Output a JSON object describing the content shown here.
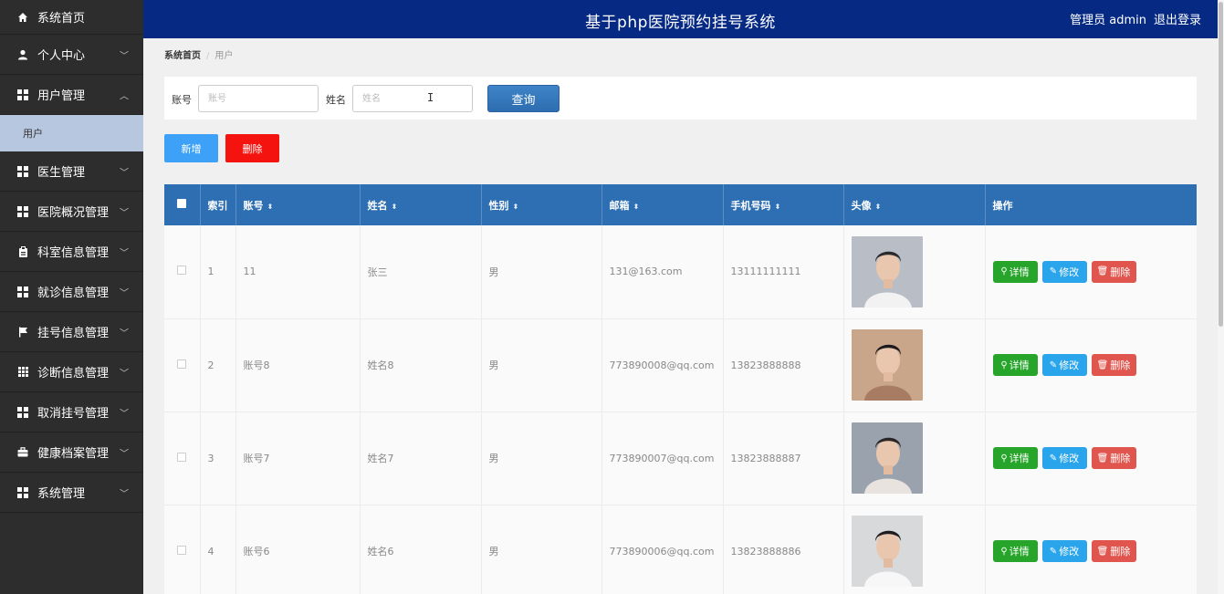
{
  "sidebar": {
    "items": [
      {
        "label": "系统首页",
        "icon": "home-icon",
        "chevron": ""
      },
      {
        "label": "个人中心",
        "icon": "user-icon",
        "chevron": "﹀"
      },
      {
        "label": "用户管理",
        "icon": "grid-icon",
        "chevron": "︿"
      },
      {
        "label": "医生管理",
        "icon": "grid-icon",
        "chevron": "﹀"
      },
      {
        "label": "医院概况管理",
        "icon": "grid-icon",
        "chevron": "﹀"
      },
      {
        "label": "科室信息管理",
        "icon": "clipboard-icon",
        "chevron": "﹀"
      },
      {
        "label": "就诊信息管理",
        "icon": "grid-icon",
        "chevron": "﹀"
      },
      {
        "label": "挂号信息管理",
        "icon": "flag-icon",
        "chevron": "﹀"
      },
      {
        "label": "诊断信息管理",
        "icon": "grid9-icon",
        "chevron": "﹀"
      },
      {
        "label": "取消挂号管理",
        "icon": "grid-icon",
        "chevron": "﹀"
      },
      {
        "label": "健康档案管理",
        "icon": "briefcase-icon",
        "chevron": "﹀"
      },
      {
        "label": "系统管理",
        "icon": "grid-icon",
        "chevron": "﹀"
      }
    ],
    "sub_item": "用户"
  },
  "header": {
    "title": "基于php医院预约挂号系统",
    "user": "管理员 admin",
    "logout": "退出登录"
  },
  "breadcrumb": {
    "home": "系统首页",
    "separator": "/",
    "current": "用户"
  },
  "search": {
    "account_label": "账号",
    "account_placeholder": "账号",
    "name_label": "姓名",
    "name_placeholder": "姓名",
    "button": "查询"
  },
  "actions": {
    "add": "新增",
    "delete": "删除"
  },
  "table": {
    "columns": [
      "索引",
      "账号",
      "姓名",
      "性别",
      "邮箱",
      "手机号码",
      "头像",
      "操作"
    ],
    "sortable_icon": "⬍",
    "rows": [
      {
        "index": "1",
        "account": "11",
        "name": "张三",
        "gender": "男",
        "email": "131@163.com",
        "phone": "13111111111"
      },
      {
        "index": "2",
        "account": "账号8",
        "name": "姓名8",
        "gender": "男",
        "email": "773890008@qq.com",
        "phone": "13823888888"
      },
      {
        "index": "3",
        "account": "账号7",
        "name": "姓名7",
        "gender": "男",
        "email": "773890007@qq.com",
        "phone": "13823888887"
      },
      {
        "index": "4",
        "account": "账号6",
        "name": "姓名6",
        "gender": "男",
        "email": "773890006@qq.com",
        "phone": "13823888886"
      }
    ],
    "ops": {
      "detail": "详情",
      "edit": "修改",
      "remove": "删除"
    }
  },
  "colors": {
    "header_bg": "#062a84",
    "sidebar_bg": "#2d2d2d",
    "table_header_bg": "#2d6fb2",
    "add_button": "#3da2f7",
    "delete_button": "#f5130f"
  }
}
